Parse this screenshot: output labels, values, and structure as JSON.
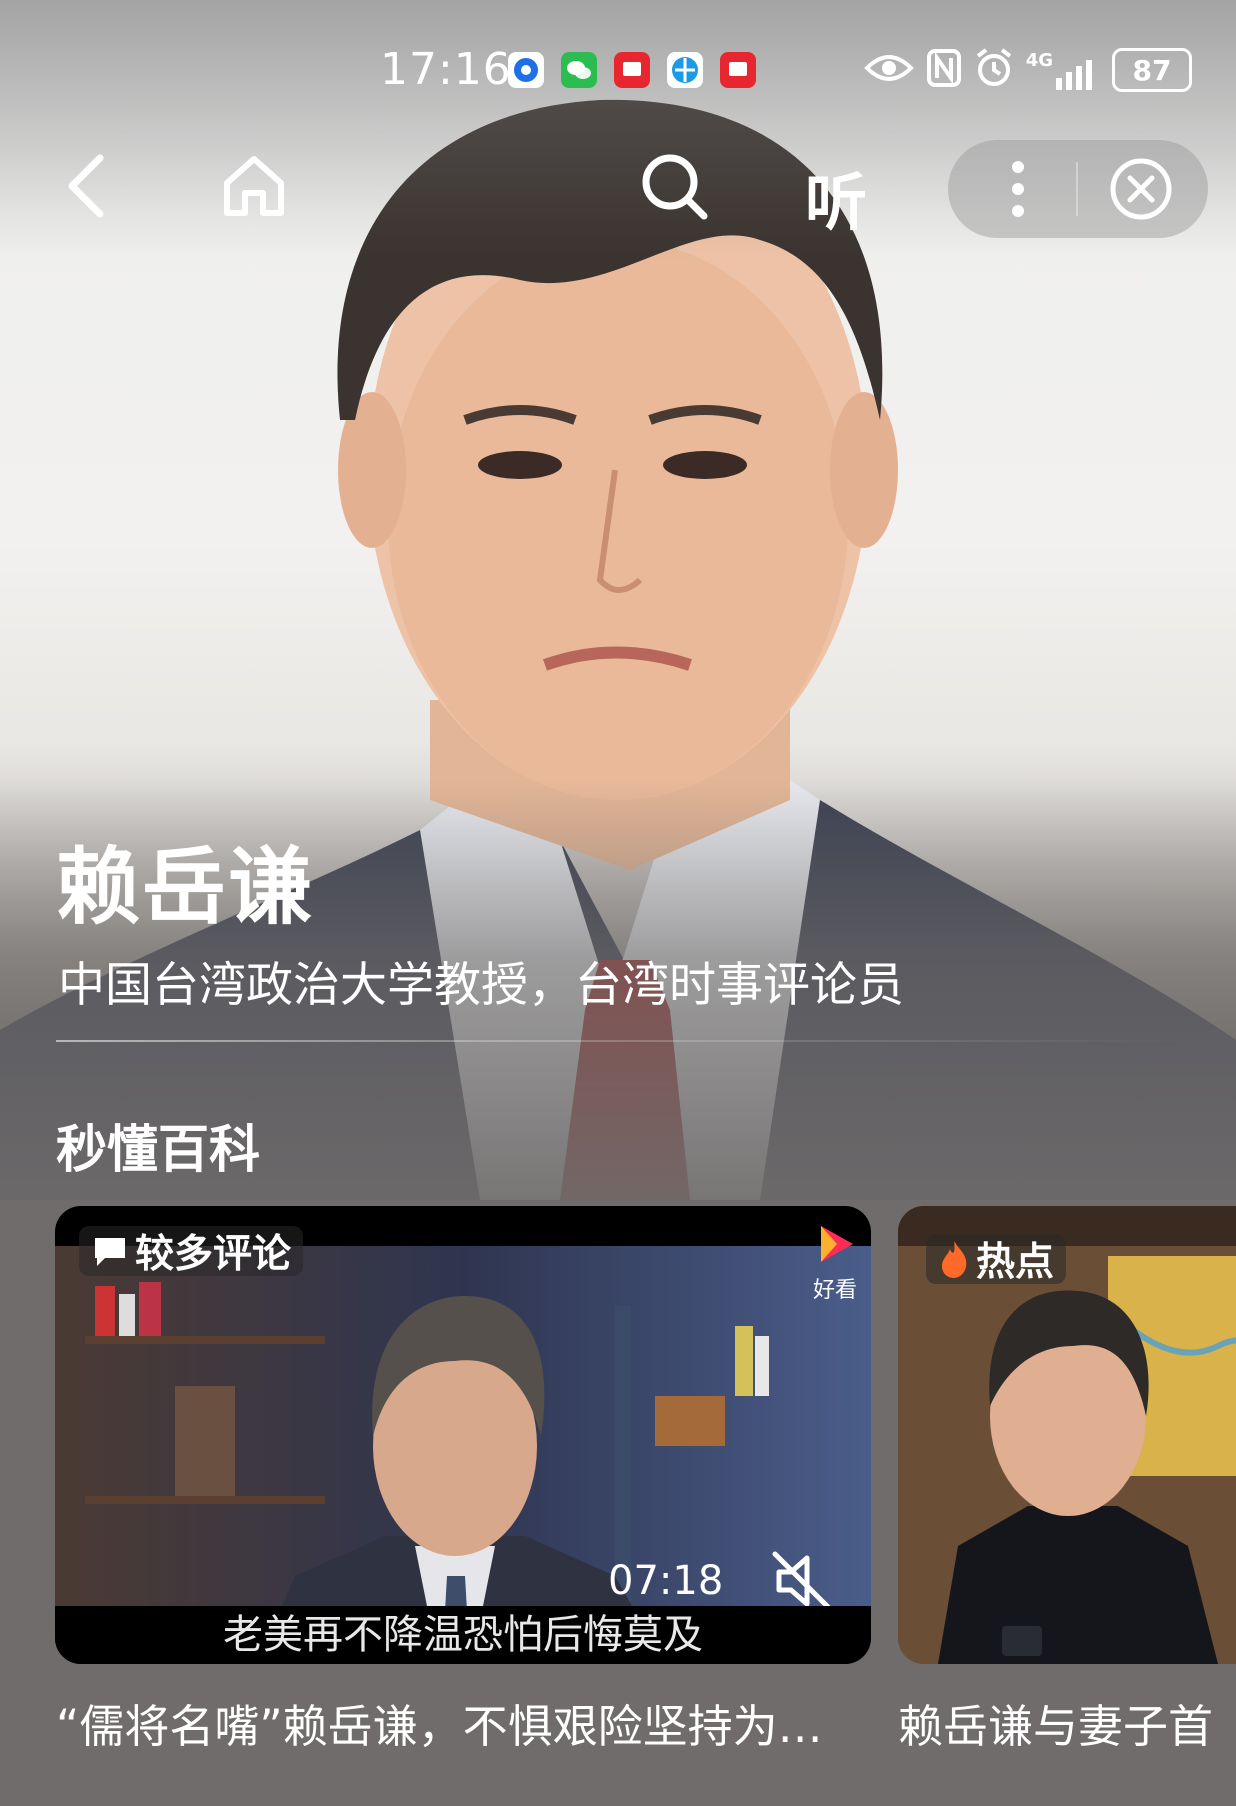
{
  "status_bar": {
    "time": "17:16",
    "battery": "87",
    "network": "4G",
    "app_icons": [
      "chat-bubble-icon",
      "wechat-icon",
      "red-book-icon",
      "browser-icon",
      "red-book-icon"
    ],
    "system_icons": [
      "eye-icon",
      "nfc-icon",
      "alarm-icon",
      "signal-icon",
      "battery-icon"
    ]
  },
  "nav": {
    "listen_label": "听"
  },
  "profile": {
    "name": "赖岳谦",
    "description": "中国台湾政治大学教授，台湾时事评论员"
  },
  "section_title": "秒懂百科",
  "videos": [
    {
      "badge": "较多评论",
      "logo_label": "好看",
      "duration": "07:18",
      "subtitle": "老美再不降温恐怕后悔莫及",
      "caption": "“儒将名嘴”赖岳谦，不惧艰险坚持为…"
    },
    {
      "badge": "热点",
      "caption": "赖岳谦与妻子首"
    }
  ],
  "colors": {
    "accent_play": "#ff2d55",
    "hot_flame": "#ff6a2b",
    "background": "#6f6c6b"
  }
}
